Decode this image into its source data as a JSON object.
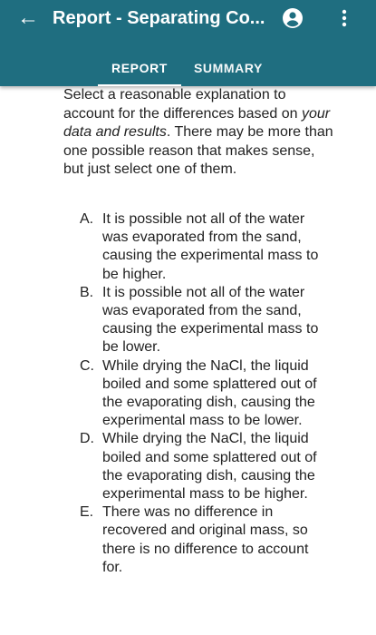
{
  "appbar": {
    "title": "Report - Separating Co...",
    "back_icon": "arrow-left-icon",
    "account_icon": "account-circle-icon",
    "more_icon": "more-vert-icon"
  },
  "tabs": [
    {
      "label": "REPORT"
    },
    {
      "label": "SUMMARY"
    }
  ],
  "question": {
    "prompt_part1": "Select a reasonable explanation to account for the differences based on ",
    "prompt_italic": "your data and results",
    "prompt_part2": ". There may be more than one possible reason that makes sense, but just select one of them."
  },
  "options": [
    {
      "letter": "A.",
      "text": "It is possible not all of the water was evaporated from the sand, causing the experimental mass to be higher."
    },
    {
      "letter": "B.",
      "text": "It is possible not all of the water was evaporated from the sand, causing the experimental mass to be lower."
    },
    {
      "letter": "C.",
      "text": "While drying the NaCl, the liquid boiled and some splattered out of the evaporating dish, causing the experimental mass to be lower."
    },
    {
      "letter": "D.",
      "text": "While drying the NaCl, the liquid boiled and some splattered out of the evaporating dish, causing the experimental mass to be higher."
    },
    {
      "letter": "E.",
      "text": "There was no difference in recovered and original mass, so there is no difference to account for."
    }
  ],
  "colors": {
    "appbar": "#1f6e80",
    "text": "#222222"
  }
}
